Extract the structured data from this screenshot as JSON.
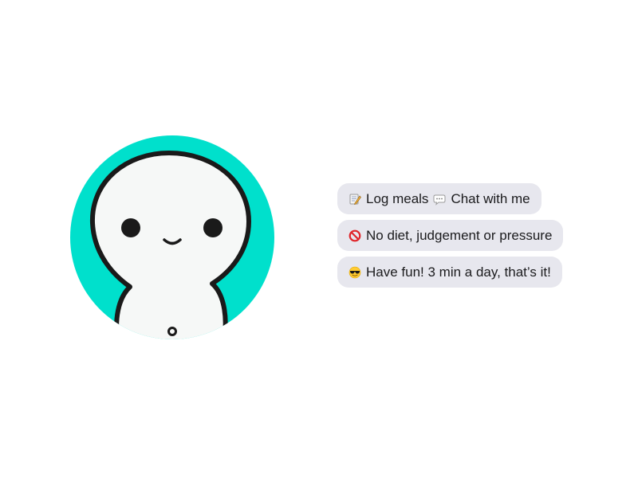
{
  "avatar": {
    "icon": "smiling-mascot-icon",
    "background_color": "#00e0cc",
    "body_color": "#f6f8f7",
    "outline_color": "#1a1a1a"
  },
  "messages": [
    {
      "parts": [
        {
          "icon": "memo-pencil-icon",
          "text": "Log meals"
        },
        {
          "icon": "speech-bubble-icon",
          "text": "Chat with me"
        }
      ]
    },
    {
      "parts": [
        {
          "icon": "no-entry-icon",
          "text": "No diet, judgement or pressure"
        }
      ]
    },
    {
      "parts": [
        {
          "icon": "sunglasses-face-icon",
          "text": "Have fun! 3 min a day, that’s it!"
        }
      ]
    }
  ],
  "colors": {
    "bubble_background": "#e7e7ee",
    "text": "#1b1b1d"
  }
}
